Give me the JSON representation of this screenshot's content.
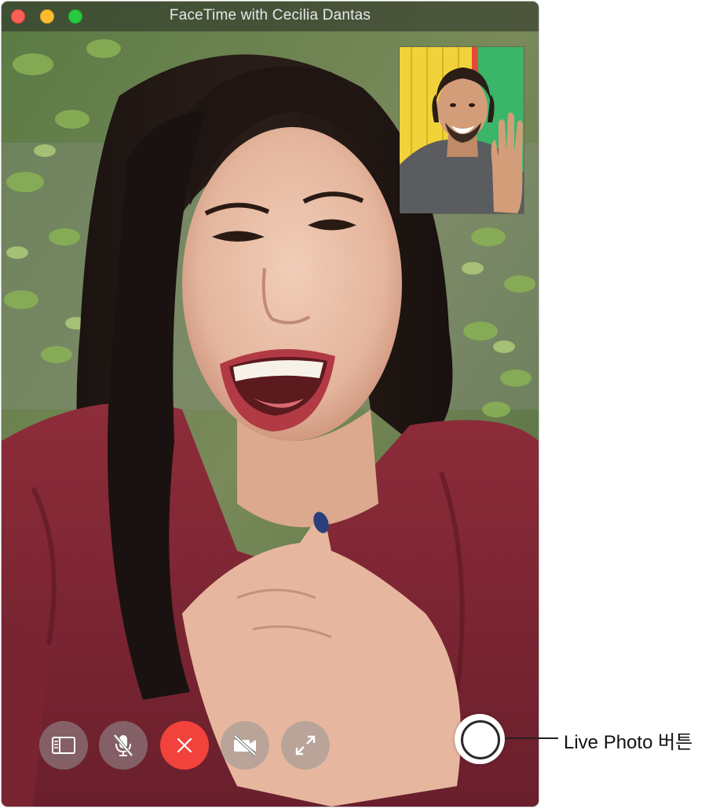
{
  "window": {
    "title": "FaceTime with Cecilia Dantas"
  },
  "controls": {
    "sidebar": "sidebar-icon",
    "mute": "mic-slash-icon",
    "end_call": "close-icon",
    "video": "video-slash-icon",
    "fullscreen": "expand-icon"
  },
  "live_photo": {
    "callout_label": "Live Photo 버튼"
  },
  "colors": {
    "end_call": "#f2423c",
    "close": "#fe5f57",
    "minimize": "#febc2e",
    "maximize": "#28c840"
  }
}
